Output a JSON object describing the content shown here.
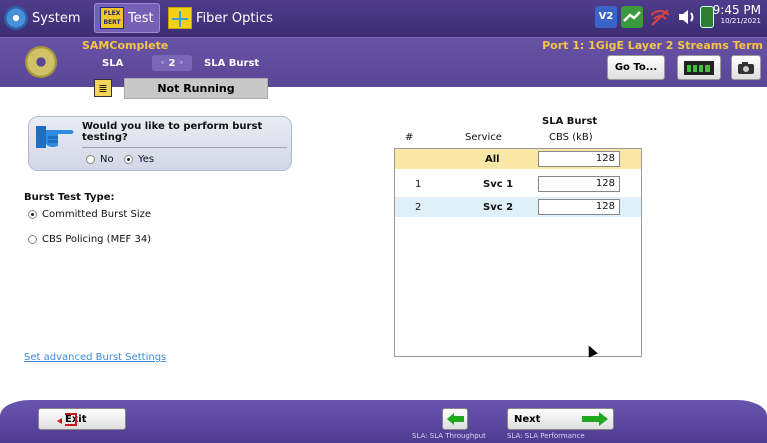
{
  "topbar": {
    "system_label": "System",
    "test_label": "Test",
    "test_icon_text": "FLEX BERT",
    "fiber_label": "Fiber Optics",
    "time": "9:45 PM",
    "date": "10/21/2021",
    "status_badge": "V2"
  },
  "header": {
    "app_name": "SAMComplete",
    "port": "Port 1: 1GigE Layer 2 Streams Term",
    "section": "SLA",
    "step": "2",
    "subsection": "SLA Burst",
    "goto_label": "Go To..."
  },
  "status": {
    "run_state": "Not Running"
  },
  "question": {
    "text": "Would you like to perform burst testing?",
    "options": [
      "No",
      "Yes"
    ],
    "selected": "Yes"
  },
  "burst_type": {
    "label": "Burst Test Type:",
    "options": [
      "Committed Burst Size",
      "CBS Policing (MEF 34)"
    ],
    "selected": "Committed Burst Size"
  },
  "advanced_link": "Set advanced Burst Settings",
  "table": {
    "col_num": "#",
    "col_service": "Service",
    "col_burst_title": "SLA Burst",
    "col_burst_unit": "CBS (kB)",
    "rows": [
      {
        "num": "",
        "service": "All",
        "cbs": "128"
      },
      {
        "num": "1",
        "service": "Svc 1",
        "cbs": "128"
      },
      {
        "num": "2",
        "service": "Svc 2",
        "cbs": "128"
      }
    ]
  },
  "bottom": {
    "exit_label": "Exit",
    "next_label": "Next",
    "back_caption": "SLA: SLA Throughput",
    "next_caption": "SLA: SLA Performance"
  },
  "colors": {
    "header_purple": "#5a4696",
    "accent_gold": "#f6c542",
    "all_row": "#f8e7a6",
    "highlight_row": "#dff0f8",
    "link": "#3d8ad6",
    "next_arrow": "#1fa81f"
  }
}
